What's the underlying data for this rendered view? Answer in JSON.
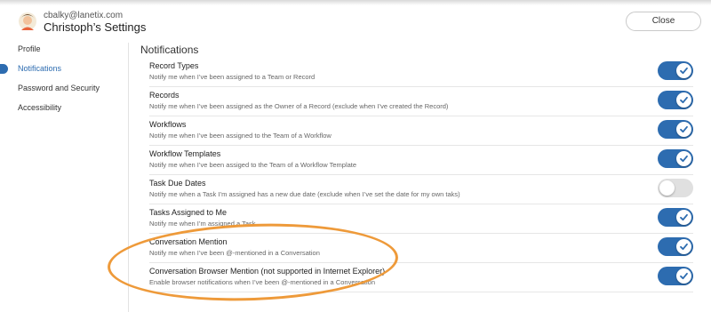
{
  "header": {
    "user_email": "cbalky@lanetix.com",
    "settings_title": "Christoph’s Settings",
    "close_label": "Close"
  },
  "sidebar": {
    "items": [
      {
        "label": "Profile",
        "active": false
      },
      {
        "label": "Notifications",
        "active": true
      },
      {
        "label": "Password and Security",
        "active": false
      },
      {
        "label": "Accessibility",
        "active": false
      }
    ]
  },
  "main": {
    "section_title": "Notifications",
    "rows": [
      {
        "title": "Record Types",
        "desc": "Notify me when I’ve been assigned to a Team or Record",
        "on": true
      },
      {
        "title": "Records",
        "desc": "Notify me when I’ve been assigned as the Owner of a Record (exclude when I’ve created the Record)",
        "on": true
      },
      {
        "title": "Workflows",
        "desc": "Notify me when I’ve been assigned to the Team of a Workflow",
        "on": true
      },
      {
        "title": "Workflow Templates",
        "desc": "Notify me when I’ve been assiged to the Team of a Workflow Template",
        "on": true
      },
      {
        "title": "Task Due Dates",
        "desc": "Notify me when a Task I’m assigned has a new due date (exclude when I’ve set the date for my own taks)",
        "on": false
      },
      {
        "title": "Tasks Assigned to Me",
        "desc": "Notify me when I’m assigned a Task",
        "on": true
      },
      {
        "title": "Conversation Mention",
        "desc": "Notify me when I’ve been @-mentioned in a Conversation",
        "on": true
      },
      {
        "title": "Conversation Browser Mention (not supported in Internet Explorer)",
        "desc": "Enable browser notifications when I’ve been @-mentioned in a Conversation",
        "on": true
      }
    ]
  },
  "colors": {
    "accent": "#2d6cb0",
    "toggle_off": "#e0e0e0",
    "highlight": "#ee9a3a"
  },
  "icons": {
    "avatar": "avatar-icon",
    "toggle_on": "check-icon"
  }
}
